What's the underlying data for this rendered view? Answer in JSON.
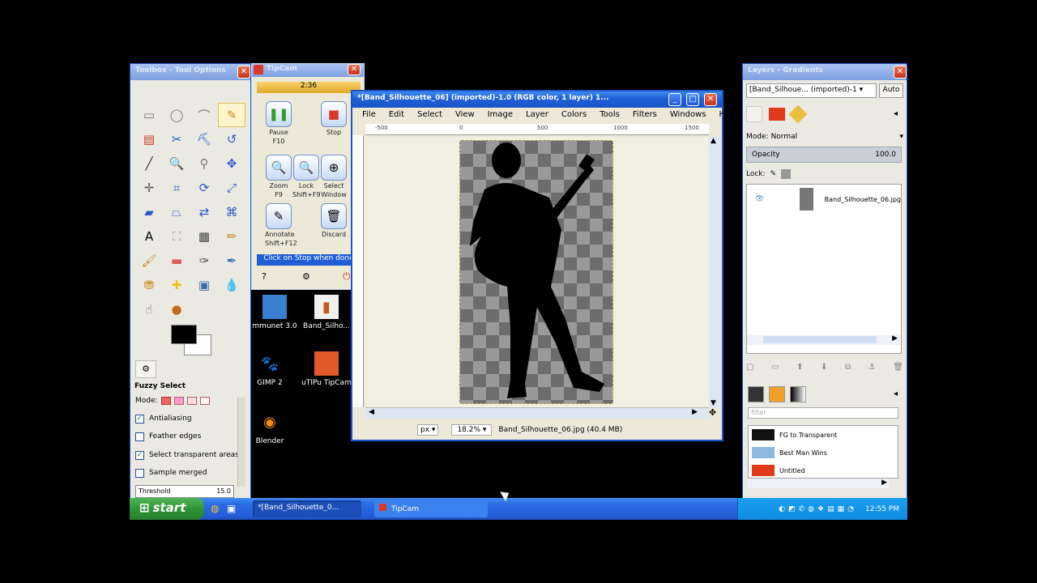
{
  "toolbox": {
    "title": "Toolbox - Tool Options",
    "tools": [
      {
        "icon": "rect-select-icon",
        "glyph": "▭"
      },
      {
        "icon": "ellipse-select-icon",
        "glyph": "◯"
      },
      {
        "icon": "free-select-icon",
        "glyph": "⌒"
      },
      {
        "icon": "fuzzy-select-icon",
        "glyph": "✎"
      },
      {
        "icon": "select-by-color-icon",
        "glyph": "▤"
      },
      {
        "icon": "scissors-icon",
        "glyph": "✂"
      },
      {
        "icon": "foreground-select-icon",
        "glyph": "⛏"
      },
      {
        "icon": "paths-icon",
        "glyph": "↺"
      },
      {
        "icon": "color-picker-icon",
        "glyph": "╱"
      },
      {
        "icon": "zoom-icon",
        "glyph": "🔍"
      },
      {
        "icon": "measure-icon",
        "glyph": "⚲"
      },
      {
        "icon": "move-icon",
        "glyph": "✥"
      },
      {
        "icon": "align-icon",
        "glyph": "✛"
      },
      {
        "icon": "crop-icon",
        "glyph": "⌗"
      },
      {
        "icon": "rotate-icon",
        "glyph": "⟳"
      },
      {
        "icon": "scale-icon",
        "glyph": "⤢"
      },
      {
        "icon": "shear-icon",
        "glyph": "▰"
      },
      {
        "icon": "perspective-icon",
        "glyph": "⏢"
      },
      {
        "icon": "flip-icon",
        "glyph": "⇄"
      },
      {
        "icon": "cage-icon",
        "glyph": "⌘"
      },
      {
        "icon": "text-icon",
        "glyph": "A"
      },
      {
        "icon": "bucket-fill-icon",
        "glyph": "⛶"
      },
      {
        "icon": "blend-icon",
        "glyph": "▦"
      },
      {
        "icon": "pencil-icon",
        "glyph": "✏"
      },
      {
        "icon": "paintbrush-icon",
        "glyph": "🖌"
      },
      {
        "icon": "eraser-icon",
        "glyph": "▬"
      },
      {
        "icon": "airbrush-icon",
        "glyph": "✑"
      },
      {
        "icon": "ink-icon",
        "glyph": "✒"
      },
      {
        "icon": "clone-icon",
        "glyph": "⛃"
      },
      {
        "icon": "heal-icon",
        "glyph": "✚"
      },
      {
        "icon": "perspective-clone-icon",
        "glyph": "▣"
      },
      {
        "icon": "blur-icon",
        "glyph": "💧"
      },
      {
        "icon": "smudge-icon",
        "glyph": "☝"
      },
      {
        "icon": "dodge-burn-icon",
        "glyph": "●"
      }
    ],
    "tool_options_title": "Fuzzy Select",
    "mode_label": "Mode:",
    "options": [
      {
        "label": "Antialiasing",
        "checked": true
      },
      {
        "label": "Feather edges",
        "checked": false
      },
      {
        "label": "Select transparent areas",
        "checked": true
      },
      {
        "label": "Sample merged",
        "checked": false
      }
    ],
    "threshold_label": "Threshold",
    "threshold_value": "15.0"
  },
  "tipcam": {
    "title": "TipCam",
    "timer": "2:36",
    "buttons": [
      {
        "line1": "Pause",
        "line2": "F10",
        "icon": "pause-icon",
        "glyph": "❚❚"
      },
      {
        "line1": "Stop",
        "line2": "",
        "icon": "stop-icon",
        "glyph": "■"
      },
      {
        "line1": "Zoom",
        "line2": "F9",
        "icon": "zoom-icon",
        "glyph": "🔍"
      },
      {
        "line1": "Lock",
        "line2": "Shift+F9",
        "icon": "lock-icon",
        "glyph": "🔍"
      },
      {
        "line1": "Select",
        "line2": "Window",
        "icon": "crosshair-icon",
        "glyph": "⊕"
      },
      {
        "line1": "Annotate",
        "line2": "Shift+F12",
        "icon": "annotate-icon",
        "glyph": "✎"
      },
      {
        "line1": "Discard",
        "line2": "",
        "icon": "trash-icon",
        "glyph": "🗑"
      }
    ],
    "hint": "Click on Stop when done"
  },
  "desktop_icons": [
    {
      "label": "mmunet 3.0",
      "glyph": "🖥"
    },
    {
      "label": "Band_Silho...",
      "glyph": "🖼"
    },
    {
      "label": "GIMP 2",
      "glyph": "🦊"
    },
    {
      "label": "uTIPu TipCam",
      "glyph": "🎞"
    },
    {
      "label": "Blender",
      "glyph": "◉"
    }
  ],
  "image_window": {
    "title": "*[Band_Silhouette_06] (imported)-1.0 (RGB color, 1 layer) 1...",
    "menus": [
      "File",
      "Edit",
      "Select",
      "View",
      "Image",
      "Layer",
      "Colors",
      "Tools",
      "Filters",
      "Windows",
      "Help"
    ],
    "ruler_ticks": [
      "-500",
      "0",
      "500",
      "1000",
      "1500"
    ],
    "unit": "px",
    "zoom": "18.2%",
    "status": "Band_Silhouette_06.jpg (40.4 MB)"
  },
  "layers": {
    "title": "Layers - Gradients",
    "image_select": "[Band_Silhoue... (imported)-1",
    "auto_label": "Auto",
    "mode_label": "Mode:",
    "mode_value": "Normal",
    "opacity_label": "Opacity",
    "opacity_value": "100.0",
    "lock_label": "Lock:",
    "layer_name": "Band_Silhouette_06.jpg",
    "filter_placeholder": "filter",
    "gradients": [
      {
        "name": "FG to Transparent",
        "color": "#111111"
      },
      {
        "name": "Best Man Wins",
        "color": "#8fb8e0"
      },
      {
        "name": "Untitled",
        "color": "#e03a1a"
      }
    ]
  },
  "taskbar": {
    "start_label": "start",
    "items": [
      "*[Band_Silhouette_0...",
      "TipCam"
    ],
    "clock": "12:55 PM"
  },
  "colors": {
    "xp_blue": "#1f5fd6",
    "start_green": "#2f9436",
    "tipcam_red": "#d93a2a"
  }
}
